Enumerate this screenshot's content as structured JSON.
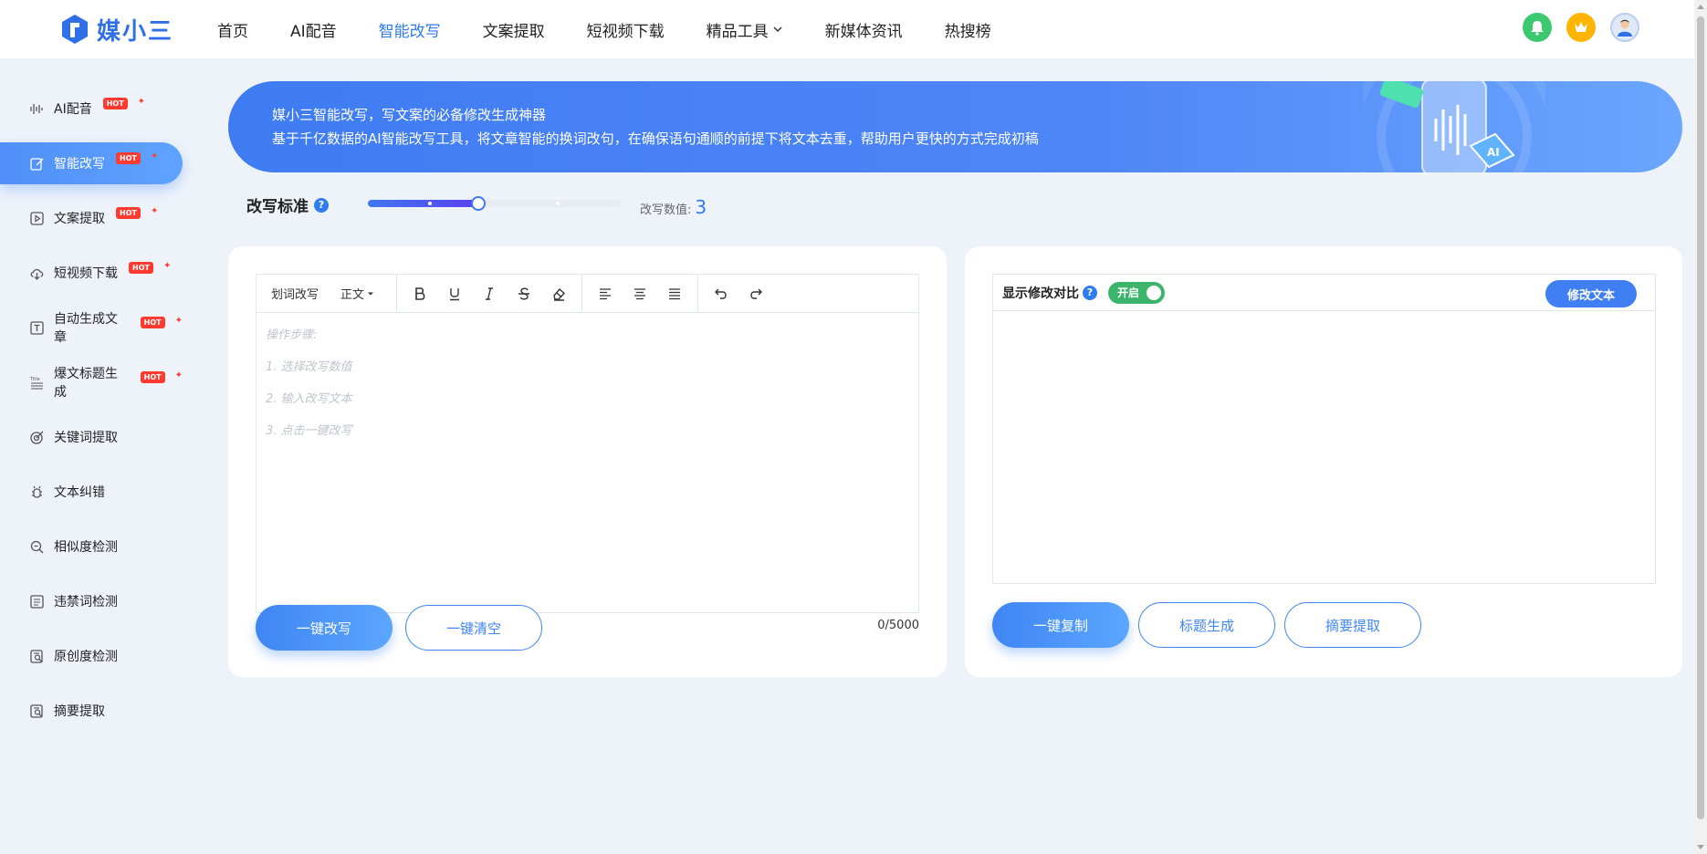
{
  "logo": {
    "text": "媒小三"
  },
  "nav": [
    {
      "label": "首页",
      "active": false
    },
    {
      "label": "AI配音",
      "active": false
    },
    {
      "label": "智能改写",
      "active": true
    },
    {
      "label": "文案提取",
      "active": false
    },
    {
      "label": "短视频下载",
      "active": false
    },
    {
      "label": "精品工具",
      "active": false,
      "dropdown": true
    },
    {
      "label": "新媒体资讯",
      "active": false
    },
    {
      "label": "热搜榜",
      "active": false
    }
  ],
  "sidebar": {
    "hot_label": "HOT",
    "items": [
      {
        "label": "AI配音",
        "icon": "waveform-icon",
        "hot": true,
        "active": false
      },
      {
        "label": "智能改写",
        "icon": "edit-icon",
        "hot": true,
        "active": true
      },
      {
        "label": "文案提取",
        "icon": "play-box-icon",
        "hot": true,
        "active": false
      },
      {
        "label": "短视频下载",
        "icon": "cloud-download-icon",
        "hot": true,
        "active": false
      },
      {
        "label": "自动生成文章",
        "icon": "text-box-icon",
        "hot": true,
        "active": false
      },
      {
        "label": "爆文标题生成",
        "icon": "title-icon",
        "hot": true,
        "active": false
      },
      {
        "label": "关键词提取",
        "icon": "target-icon",
        "hot": false,
        "active": false
      },
      {
        "label": "文本纠错",
        "icon": "bug-icon",
        "hot": false,
        "active": false
      },
      {
        "label": "相似度检测",
        "icon": "search-icon",
        "hot": false,
        "active": false
      },
      {
        "label": "违禁词检测",
        "icon": "list-box-icon",
        "hot": false,
        "active": false
      },
      {
        "label": "原创度检测",
        "icon": "doc-search-icon",
        "hot": false,
        "active": false
      },
      {
        "label": "摘要提取",
        "icon": "doc-search-icon",
        "hot": false,
        "active": false
      }
    ]
  },
  "banner": {
    "line1": "媒小三智能改写，写文案的必备修改生成神器",
    "line2": "基于千亿数据的AI智能改写工具，将文章智能的换词改句，在确保语句通顺的前提下将文本去重，帮助用户更快的方式完成初稿"
  },
  "rewrite": {
    "label": "改写标准",
    "help": "?",
    "value_label": "改写数值:",
    "value": "3",
    "slider": {
      "min": 1,
      "max": 5,
      "value": 3
    }
  },
  "editor": {
    "toolbar_word": "划词改写",
    "toolbar_style": "正文",
    "placeholder": [
      "操作步骤:",
      "1. 选择改写数值",
      "2. 输入改写文本",
      "3. 点击一键改写"
    ],
    "counter": "0/5000",
    "rewrite_btn": "一键改写",
    "clear_btn": "一键清空"
  },
  "result": {
    "compare_label": "显示修改对比",
    "help": "?",
    "toggle_label": "开启",
    "modify_btn": "修改文本",
    "copy_btn": "一键复制",
    "title_btn": "标题生成",
    "summary_btn": "摘要提取"
  },
  "colors": {
    "primary": "#2f7bf0",
    "hot": "#ff3b30",
    "toggle_on": "#3cb56c"
  }
}
